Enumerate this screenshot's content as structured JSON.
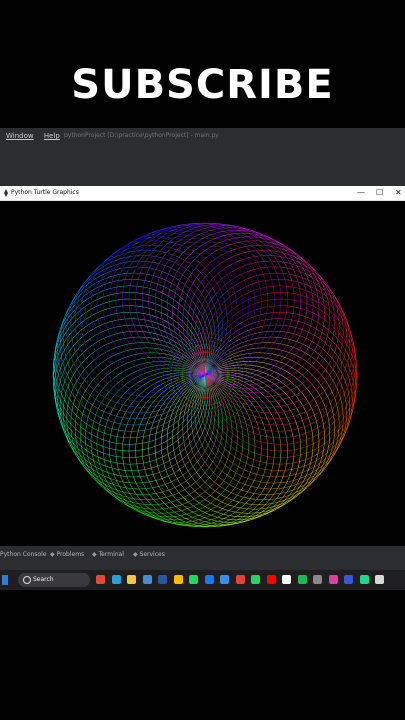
{
  "banner": {
    "text": "SUBSCRIBE"
  },
  "ide": {
    "menu_window": "Window",
    "menu_help": "Help",
    "project_path": "pythonProject [D:\\practice\\pythonProject] - main.py"
  },
  "turtle_window": {
    "title": "Python Turtle Graphics",
    "minimize": "—",
    "maximize": "☐",
    "close": "✕"
  },
  "bottom_tabs": [
    {
      "label": "Python Console",
      "icon": "console-icon"
    },
    {
      "label": "Problems",
      "icon": "problems-icon"
    },
    {
      "label": "Terminal",
      "icon": "terminal-icon"
    },
    {
      "label": "Services",
      "icon": "services-icon"
    }
  ],
  "taskbar": {
    "search_label": "Search",
    "apps": [
      {
        "name": "chrome-icon",
        "color": "#e44a3b"
      },
      {
        "name": "edge-icon",
        "color": "#2aa0d8"
      },
      {
        "name": "explorer-icon",
        "color": "#f4c543"
      },
      {
        "name": "photos-icon",
        "color": "#4a8bd6"
      },
      {
        "name": "word-icon",
        "color": "#2b579a"
      },
      {
        "name": "chrome-icon",
        "color": "#fbbc05"
      },
      {
        "name": "pycharm-icon",
        "color": "#1ed760"
      },
      {
        "name": "facebook-icon",
        "color": "#1877f2"
      },
      {
        "name": "app-icon",
        "color": "#3a8ee6"
      },
      {
        "name": "recorder-icon",
        "color": "#e0443b"
      },
      {
        "name": "whatsapp-icon",
        "color": "#25d366"
      },
      {
        "name": "youtube-icon",
        "color": "#ff0000"
      },
      {
        "name": "notion-icon",
        "color": "#ffffff"
      },
      {
        "name": "spotify-icon",
        "color": "#1db954"
      },
      {
        "name": "app-icon",
        "color": "#888888"
      },
      {
        "name": "game-icon",
        "color": "#e03e9c"
      },
      {
        "name": "app-icon",
        "color": "#3b57d6"
      },
      {
        "name": "pycharm-icon",
        "color": "#21d789"
      },
      {
        "name": "app-icon",
        "color": "#d8d8d8"
      }
    ]
  },
  "spiral": {
    "colors": [
      "#ff0000",
      "#ffff00",
      "#00ff00",
      "#00ffff",
      "#0000ff",
      "#ff00ff"
    ]
  }
}
